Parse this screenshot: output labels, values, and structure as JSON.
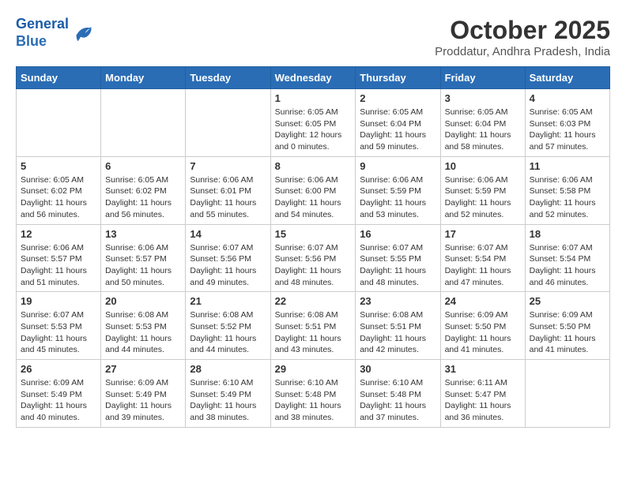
{
  "logo": {
    "line1": "General",
    "line2": "Blue"
  },
  "title": "October 2025",
  "subtitle": "Proddatur, Andhra Pradesh, India",
  "weekdays": [
    "Sunday",
    "Monday",
    "Tuesday",
    "Wednesday",
    "Thursday",
    "Friday",
    "Saturday"
  ],
  "weeks": [
    [
      {
        "day": "",
        "info": ""
      },
      {
        "day": "",
        "info": ""
      },
      {
        "day": "",
        "info": ""
      },
      {
        "day": "1",
        "info": "Sunrise: 6:05 AM\nSunset: 6:05 PM\nDaylight: 12 hours\nand 0 minutes."
      },
      {
        "day": "2",
        "info": "Sunrise: 6:05 AM\nSunset: 6:04 PM\nDaylight: 11 hours\nand 59 minutes."
      },
      {
        "day": "3",
        "info": "Sunrise: 6:05 AM\nSunset: 6:04 PM\nDaylight: 11 hours\nand 58 minutes."
      },
      {
        "day": "4",
        "info": "Sunrise: 6:05 AM\nSunset: 6:03 PM\nDaylight: 11 hours\nand 57 minutes."
      }
    ],
    [
      {
        "day": "5",
        "info": "Sunrise: 6:05 AM\nSunset: 6:02 PM\nDaylight: 11 hours\nand 56 minutes."
      },
      {
        "day": "6",
        "info": "Sunrise: 6:05 AM\nSunset: 6:02 PM\nDaylight: 11 hours\nand 56 minutes."
      },
      {
        "day": "7",
        "info": "Sunrise: 6:06 AM\nSunset: 6:01 PM\nDaylight: 11 hours\nand 55 minutes."
      },
      {
        "day": "8",
        "info": "Sunrise: 6:06 AM\nSunset: 6:00 PM\nDaylight: 11 hours\nand 54 minutes."
      },
      {
        "day": "9",
        "info": "Sunrise: 6:06 AM\nSunset: 5:59 PM\nDaylight: 11 hours\nand 53 minutes."
      },
      {
        "day": "10",
        "info": "Sunrise: 6:06 AM\nSunset: 5:59 PM\nDaylight: 11 hours\nand 52 minutes."
      },
      {
        "day": "11",
        "info": "Sunrise: 6:06 AM\nSunset: 5:58 PM\nDaylight: 11 hours\nand 52 minutes."
      }
    ],
    [
      {
        "day": "12",
        "info": "Sunrise: 6:06 AM\nSunset: 5:57 PM\nDaylight: 11 hours\nand 51 minutes."
      },
      {
        "day": "13",
        "info": "Sunrise: 6:06 AM\nSunset: 5:57 PM\nDaylight: 11 hours\nand 50 minutes."
      },
      {
        "day": "14",
        "info": "Sunrise: 6:07 AM\nSunset: 5:56 PM\nDaylight: 11 hours\nand 49 minutes."
      },
      {
        "day": "15",
        "info": "Sunrise: 6:07 AM\nSunset: 5:56 PM\nDaylight: 11 hours\nand 48 minutes."
      },
      {
        "day": "16",
        "info": "Sunrise: 6:07 AM\nSunset: 5:55 PM\nDaylight: 11 hours\nand 48 minutes."
      },
      {
        "day": "17",
        "info": "Sunrise: 6:07 AM\nSunset: 5:54 PM\nDaylight: 11 hours\nand 47 minutes."
      },
      {
        "day": "18",
        "info": "Sunrise: 6:07 AM\nSunset: 5:54 PM\nDaylight: 11 hours\nand 46 minutes."
      }
    ],
    [
      {
        "day": "19",
        "info": "Sunrise: 6:07 AM\nSunset: 5:53 PM\nDaylight: 11 hours\nand 45 minutes."
      },
      {
        "day": "20",
        "info": "Sunrise: 6:08 AM\nSunset: 5:53 PM\nDaylight: 11 hours\nand 44 minutes."
      },
      {
        "day": "21",
        "info": "Sunrise: 6:08 AM\nSunset: 5:52 PM\nDaylight: 11 hours\nand 44 minutes."
      },
      {
        "day": "22",
        "info": "Sunrise: 6:08 AM\nSunset: 5:51 PM\nDaylight: 11 hours\nand 43 minutes."
      },
      {
        "day": "23",
        "info": "Sunrise: 6:08 AM\nSunset: 5:51 PM\nDaylight: 11 hours\nand 42 minutes."
      },
      {
        "day": "24",
        "info": "Sunrise: 6:09 AM\nSunset: 5:50 PM\nDaylight: 11 hours\nand 41 minutes."
      },
      {
        "day": "25",
        "info": "Sunrise: 6:09 AM\nSunset: 5:50 PM\nDaylight: 11 hours\nand 41 minutes."
      }
    ],
    [
      {
        "day": "26",
        "info": "Sunrise: 6:09 AM\nSunset: 5:49 PM\nDaylight: 11 hours\nand 40 minutes."
      },
      {
        "day": "27",
        "info": "Sunrise: 6:09 AM\nSunset: 5:49 PM\nDaylight: 11 hours\nand 39 minutes."
      },
      {
        "day": "28",
        "info": "Sunrise: 6:10 AM\nSunset: 5:49 PM\nDaylight: 11 hours\nand 38 minutes."
      },
      {
        "day": "29",
        "info": "Sunrise: 6:10 AM\nSunset: 5:48 PM\nDaylight: 11 hours\nand 38 minutes."
      },
      {
        "day": "30",
        "info": "Sunrise: 6:10 AM\nSunset: 5:48 PM\nDaylight: 11 hours\nand 37 minutes."
      },
      {
        "day": "31",
        "info": "Sunrise: 6:11 AM\nSunset: 5:47 PM\nDaylight: 11 hours\nand 36 minutes."
      },
      {
        "day": "",
        "info": ""
      }
    ]
  ]
}
